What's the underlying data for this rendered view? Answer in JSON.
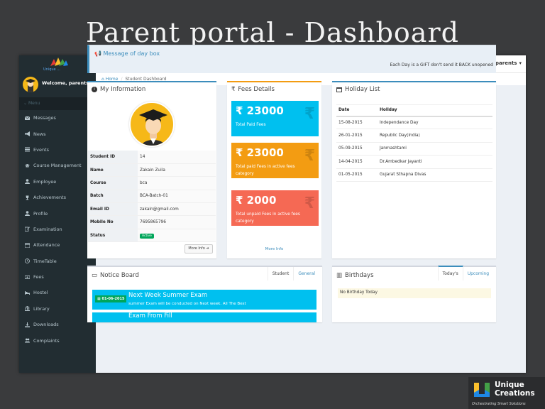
{
  "slide": {
    "title": "Parent portal - Dashboard"
  },
  "sidebar": {
    "logo_text": "Unique ...",
    "welcome": "Welcome, parents",
    "menu_header": "Menu",
    "items": [
      {
        "label": "Messages",
        "icon": "envelope-icon"
      },
      {
        "label": "News",
        "icon": "bullhorn-icon"
      },
      {
        "label": "Events",
        "icon": "calendar-list-icon"
      },
      {
        "label": "Course Management",
        "icon": "graduation-cap-icon"
      },
      {
        "label": "Employee",
        "icon": "user-icon"
      },
      {
        "label": "Achievements",
        "icon": "trophy-icon"
      },
      {
        "label": "Profile",
        "icon": "user-icon"
      },
      {
        "label": "Examination",
        "icon": "edit-icon"
      },
      {
        "label": "Attendance",
        "icon": "calendar-icon"
      },
      {
        "label": "TimeTable",
        "icon": "clock-icon"
      },
      {
        "label": "Fees",
        "icon": "money-icon"
      },
      {
        "label": "Hostel",
        "icon": "bed-icon"
      },
      {
        "label": "Library",
        "icon": "bank-icon"
      },
      {
        "label": "Downloads",
        "icon": "download-icon"
      },
      {
        "label": "Complaints",
        "icon": "users-icon"
      }
    ]
  },
  "topbar": {
    "user": "parents"
  },
  "breadcrumb": {
    "home": "Home",
    "current": "Student Dashboard"
  },
  "message": {
    "title": "Message of day box",
    "text": "Each Day is a GIFT don't send it BACK unopened"
  },
  "my_info": {
    "title": "My Information",
    "rows": [
      {
        "key": "Student ID",
        "value": "14"
      },
      {
        "key": "Name",
        "value": "Zakain Zuila"
      },
      {
        "key": "Course",
        "value": "bca"
      },
      {
        "key": "Batch",
        "value": "BCA-Batch-01"
      },
      {
        "key": "Email ID",
        "value": "zakain@gmail.com"
      },
      {
        "key": "Mobile No",
        "value": "7695865796"
      }
    ],
    "status_label": "Status",
    "status_value": "Active",
    "more_info": "More Info"
  },
  "fees": {
    "title": "Fees Details",
    "cards": [
      {
        "amount": "₹ 23000",
        "label": "Total Paid Fees",
        "color": "#00c0ef"
      },
      {
        "amount": "₹ 23000",
        "label": "Total paid Fees in active fees category",
        "color": "#f39c12"
      },
      {
        "amount": "₹ 2000",
        "label": "Total unpaid Fees in active fees category",
        "color": "#f56954"
      }
    ],
    "more_info": "More Info"
  },
  "holidays": {
    "title": "Holiday List",
    "headers": {
      "date": "Date",
      "holiday": "Holiday"
    },
    "rows": [
      {
        "date": "15-08-2015",
        "holiday": "Independance Day"
      },
      {
        "date": "26-01-2015",
        "holiday": "Republic Day(India)"
      },
      {
        "date": "05-09-2015",
        "holiday": "Janmashtami"
      },
      {
        "date": "14-04-2015",
        "holiday": "Dr.Ambedkar Jayanti"
      },
      {
        "date": "01-05-2015",
        "holiday": "Gujarat Sthapna Divas"
      }
    ]
  },
  "notice": {
    "title": "Notice Board",
    "tabs": [
      "Student",
      "General"
    ],
    "items": [
      {
        "date": "01-06-2015",
        "title": "Next Week Summer Exam",
        "desc": "summer Exam will be conducted on Next week. All The Best"
      },
      {
        "date": "",
        "title": "Exam From Fill",
        "desc": ""
      }
    ]
  },
  "birthdays": {
    "title": "Birthdays",
    "tabs": [
      "Today's",
      "Upcoming"
    ],
    "empty": "No Birthday Today"
  },
  "brand": {
    "line1": "Unique",
    "line2": "Creations",
    "tagline": "Orchestrating Smart Solutions"
  },
  "colors": {
    "accent": "#3c8dbc",
    "sidebar": "#222d32",
    "success": "#00a65a"
  }
}
